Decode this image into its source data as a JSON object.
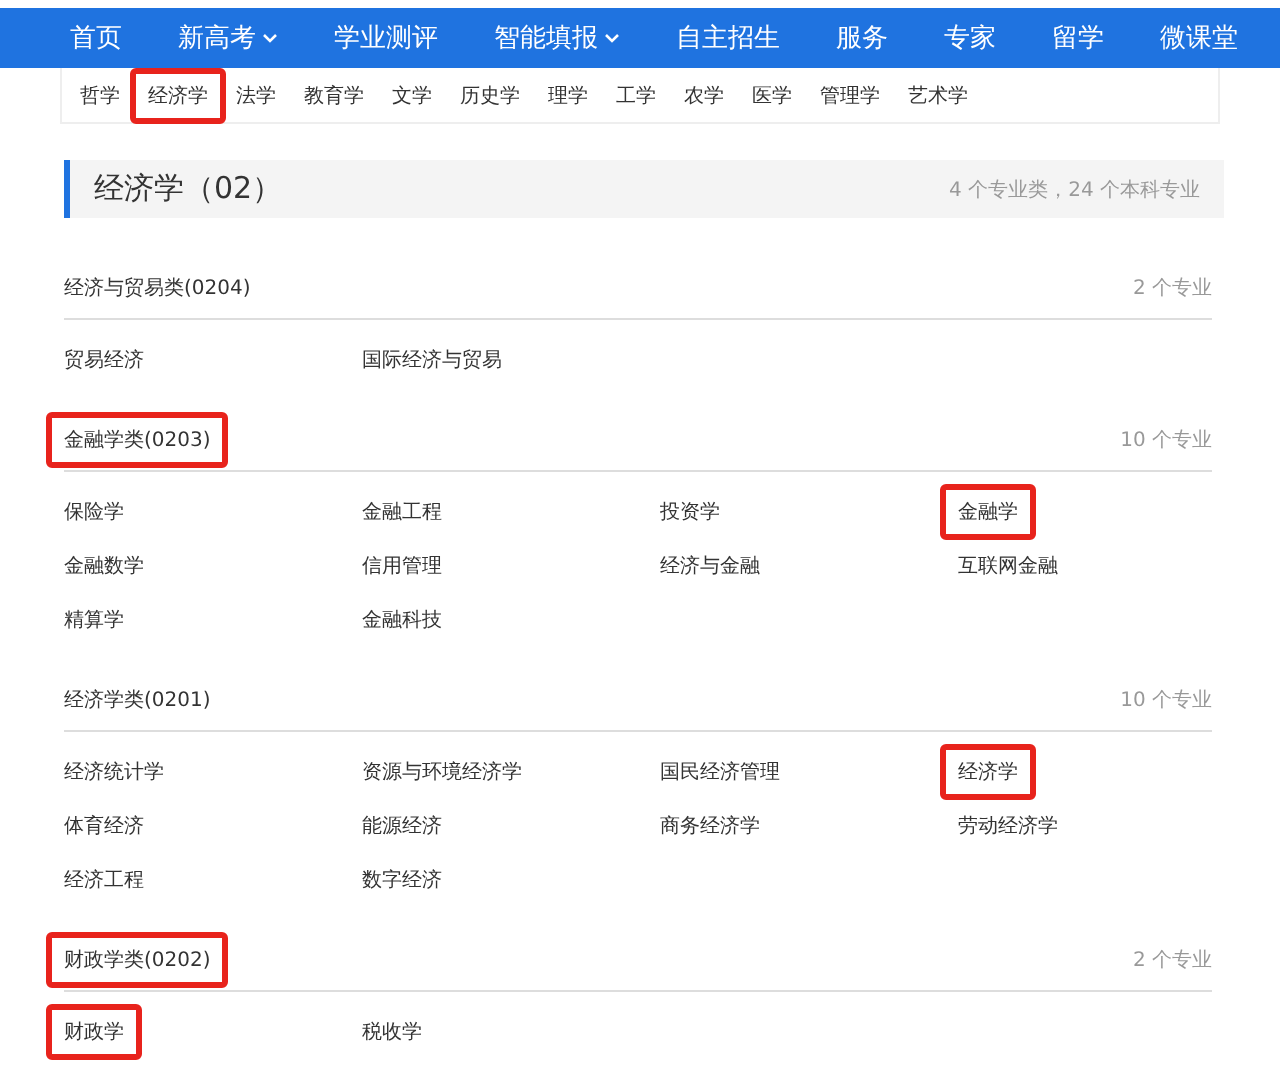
{
  "nav": [
    {
      "label": "首页",
      "dropdown": false
    },
    {
      "label": "新高考",
      "dropdown": true
    },
    {
      "label": "学业测评",
      "dropdown": false
    },
    {
      "label": "智能填报",
      "dropdown": true
    },
    {
      "label": "自主招生",
      "dropdown": false
    },
    {
      "label": "服务",
      "dropdown": false
    },
    {
      "label": "专家",
      "dropdown": false
    },
    {
      "label": "留学",
      "dropdown": false
    },
    {
      "label": "微课堂",
      "dropdown": false
    }
  ],
  "disciplines": [
    {
      "label": "哲学",
      "highlighted": false
    },
    {
      "label": "经济学",
      "highlighted": true
    },
    {
      "label": "法学",
      "highlighted": false
    },
    {
      "label": "教育学",
      "highlighted": false
    },
    {
      "label": "文学",
      "highlighted": false
    },
    {
      "label": "历史学",
      "highlighted": false
    },
    {
      "label": "理学",
      "highlighted": false
    },
    {
      "label": "工学",
      "highlighted": false
    },
    {
      "label": "农学",
      "highlighted": false
    },
    {
      "label": "医学",
      "highlighted": false
    },
    {
      "label": "管理学",
      "highlighted": false
    },
    {
      "label": "艺术学",
      "highlighted": false
    }
  ],
  "heading": {
    "title": "经济学（02）",
    "summary": "4 个专业类，24 个本科专业"
  },
  "categories": [
    {
      "name": "经济与贸易类(0204)",
      "count": "2 个专业",
      "highlighted": false,
      "majors": [
        {
          "label": "贸易经济",
          "highlighted": false
        },
        {
          "label": "国际经济与贸易",
          "highlighted": false
        }
      ]
    },
    {
      "name": "金融学类(0203)",
      "count": "10 个专业",
      "highlighted": true,
      "majors": [
        {
          "label": "保险学",
          "highlighted": false
        },
        {
          "label": "金融工程",
          "highlighted": false
        },
        {
          "label": "投资学",
          "highlighted": false
        },
        {
          "label": "金融学",
          "highlighted": true
        },
        {
          "label": "金融数学",
          "highlighted": false
        },
        {
          "label": "信用管理",
          "highlighted": false
        },
        {
          "label": "经济与金融",
          "highlighted": false
        },
        {
          "label": "互联网金融",
          "highlighted": false
        },
        {
          "label": "精算学",
          "highlighted": false
        },
        {
          "label": "金融科技",
          "highlighted": false
        }
      ]
    },
    {
      "name": "经济学类(0201)",
      "count": "10 个专业",
      "highlighted": false,
      "majors": [
        {
          "label": "经济统计学",
          "highlighted": false
        },
        {
          "label": "资源与环境经济学",
          "highlighted": false
        },
        {
          "label": "国民经济管理",
          "highlighted": false
        },
        {
          "label": "经济学",
          "highlighted": true
        },
        {
          "label": "体育经济",
          "highlighted": false
        },
        {
          "label": "能源经济",
          "highlighted": false
        },
        {
          "label": "商务经济学",
          "highlighted": false
        },
        {
          "label": "劳动经济学",
          "highlighted": false
        },
        {
          "label": "经济工程",
          "highlighted": false
        },
        {
          "label": "数字经济",
          "highlighted": false
        }
      ]
    },
    {
      "name": "财政学类(0202)",
      "count": "2 个专业",
      "highlighted": true,
      "majors": [
        {
          "label": "财政学",
          "highlighted": true
        },
        {
          "label": "税收学",
          "highlighted": false
        }
      ]
    }
  ]
}
